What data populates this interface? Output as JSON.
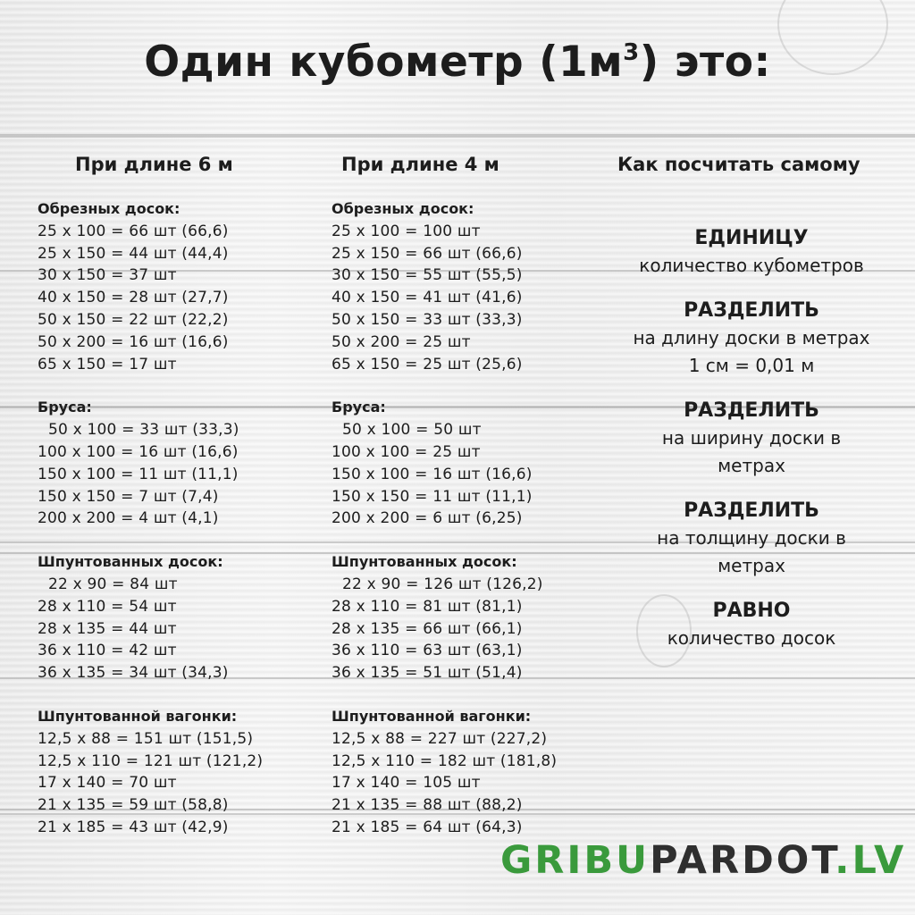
{
  "title": {
    "main": "Один кубометр (1м",
    "sup": "3",
    "tail": ") это:"
  },
  "col6": {
    "heading": "При длине 6 м",
    "groups": [
      {
        "title": "Обрезных досок:",
        "rows": [
          "25 x 100 = 66 шт (66,6)",
          "25 x 150 = 44 шт (44,4)",
          "30 x 150 = 37 шт",
          "40 x 150 = 28 шт (27,7)",
          "50 x 150 = 22 шт (22,2)",
          "50 x 200 = 16 шт (16,6)",
          "65 x 150 = 17 шт"
        ]
      },
      {
        "title": "Бруса:",
        "rows": [
          "50 x 100 = 33 шт (33,3)",
          "100 x 100 = 16 шт (16,6)",
          "150 x 100 = 11 шт (11,1)",
          "150 x 150 = 7 шт (7,4)",
          "200 x 200 = 4 шт (4,1)"
        ]
      },
      {
        "title": "Шпунтованных досок:",
        "rows": [
          "22 x 90 = 84 шт",
          "28 x 110 = 54 шт",
          "28 x 135 = 44 шт",
          "36 x 110 = 42 шт",
          "36 x 135 = 34 шт (34,3)"
        ]
      },
      {
        "title": "Шпунтованной вагонки:",
        "rows": [
          "12,5 x 88 = 151 шт (151,5)",
          "12,5 x 110 = 121 шт (121,2)",
          "17 x 140 = 70 шт",
          "21 x 135 = 59 шт (58,8)",
          "21 x 185 = 43 шт (42,9)"
        ]
      }
    ]
  },
  "col4": {
    "heading": "При длине 4 м",
    "groups": [
      {
        "title": "Обрезных досок:",
        "rows": [
          "25 x 100 = 100 шт",
          "25 x 150 = 66 шт (66,6)",
          "30 x 150 = 55 шт (55,5)",
          "40 x 150 = 41 шт (41,6)",
          "50 x 150 = 33 шт (33,3)",
          "50 x 200 = 25 шт",
          "65 x 150 = 25 шт (25,6)"
        ]
      },
      {
        "title": "Бруса:",
        "rows": [
          "50 x 100 = 50 шт",
          "100 x 100 = 25 шт",
          "150 x 100 = 16 шт (16,6)",
          "150 x 150 = 11 шт (11,1)",
          "200 x 200 = 6 шт (6,25)"
        ]
      },
      {
        "title": "Шпунтованных досок:",
        "rows": [
          "22 x 90 = 126 шт (126,2)",
          "28 x 110 = 81 шт (81,1)",
          "28 x 135 = 66 шт (66,1)",
          "36 x 110 = 63 шт (63,1)",
          "36 x 135 = 51 шт (51,4)"
        ]
      },
      {
        "title": "Шпунтованной вагонки:",
        "rows": [
          "12,5 x 88 = 227 шт (227,2)",
          "12,5 x 110 = 182 шт (181,8)",
          "17 x 140 = 105 шт",
          "21 x 135 = 88 шт (88,2)",
          "21 x 185 = 64 шт (64,3)"
        ]
      }
    ]
  },
  "howto": {
    "heading": "Как посчитать самому",
    "steps": [
      {
        "head": "ЕДИНИЦУ",
        "lines": [
          "количество кубометров"
        ]
      },
      {
        "head": "РАЗДЕЛИТЬ",
        "lines": [
          "на длину доски в метрах",
          "1 см = 0,01 м"
        ]
      },
      {
        "head": "РАЗДЕЛИТЬ",
        "lines": [
          "на ширину доски в",
          "метрах"
        ]
      },
      {
        "head": "РАЗДЕЛИТЬ",
        "lines": [
          "на толщину доски в",
          "метрах"
        ]
      },
      {
        "head": "РАВНО",
        "lines": [
          "количество досок"
        ]
      }
    ]
  },
  "brand": {
    "green": "GRIBU",
    "dark": "PARDOT",
    "suffix": ".LV"
  },
  "colors": {
    "brand_green": "#3a9a3c",
    "text": "#1d1d1d",
    "background": "#eeeeee"
  }
}
